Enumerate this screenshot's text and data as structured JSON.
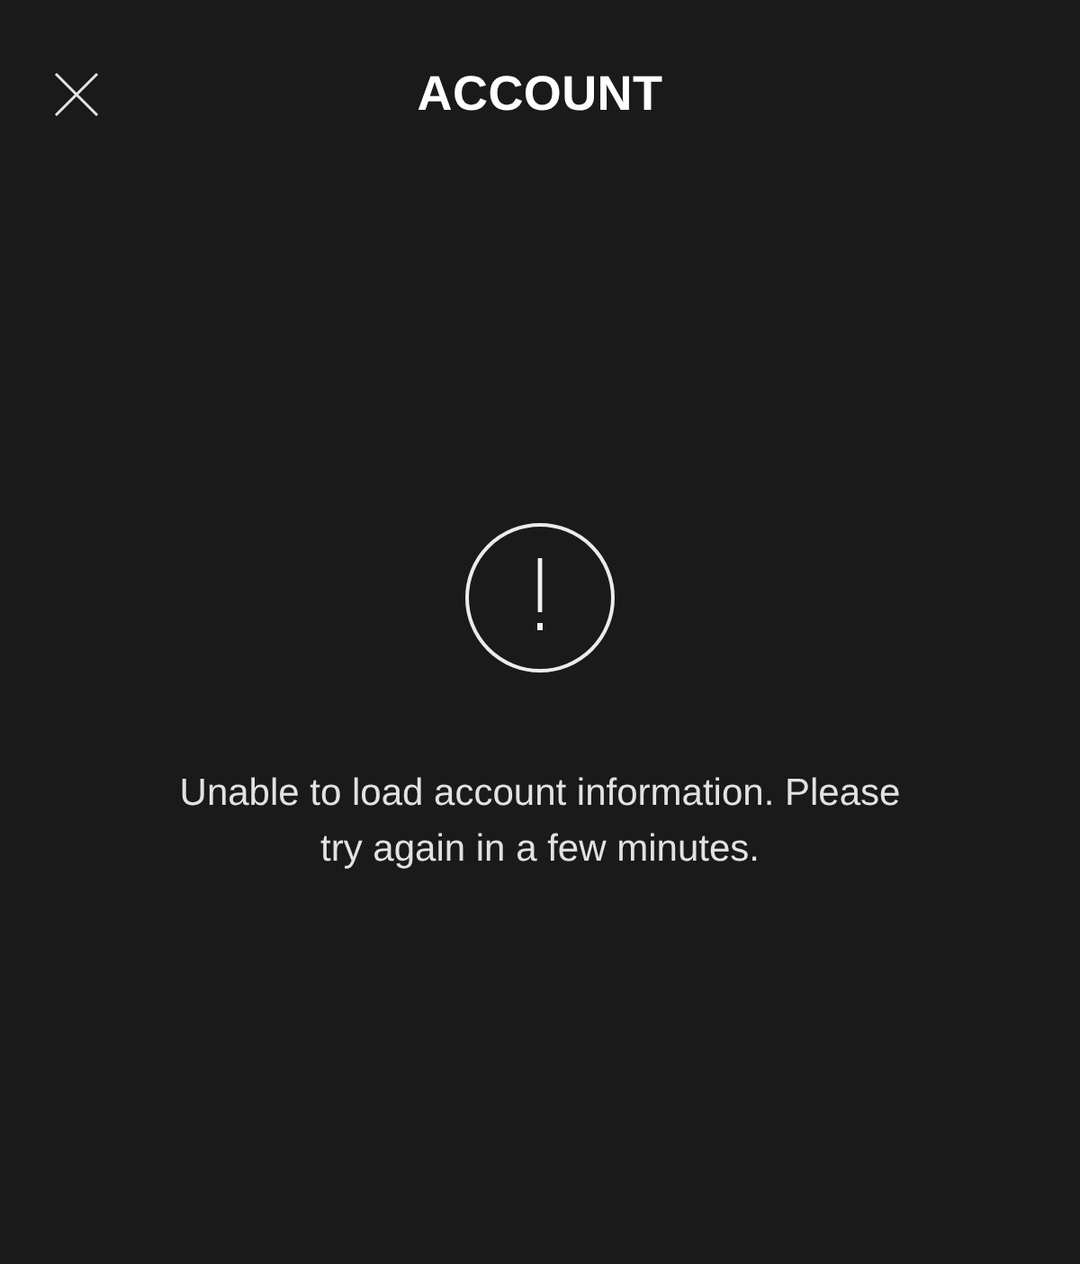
{
  "header": {
    "title": "ACCOUNT"
  },
  "error": {
    "message": "Unable to load account information. Please try again in a few minutes."
  }
}
